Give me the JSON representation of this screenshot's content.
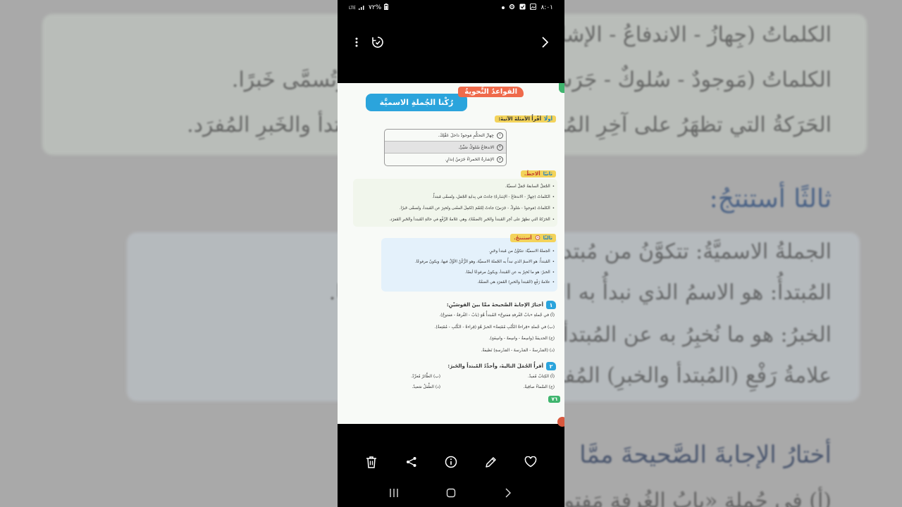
{
  "status": {
    "time": "٨:٠١",
    "battery": "%٧٢",
    "network": "LTE",
    "icons": [
      "dot-icon",
      "gear-icon",
      "check-icon",
      "gallery-icon"
    ]
  },
  "toolbar": {
    "more_icon": "more-vertical-icon",
    "rotate_icon": "rotate-icon",
    "forward_icon": "chevron-right-icon"
  },
  "document": {
    "lesson_badge": "القواعدُ النَّحويةُ",
    "lesson_title": "رُكْنا الجُملةِ الاسميَّة",
    "section1": {
      "number": "أولًا",
      "label": "أقْرأُ الأمثلةَ الآتيةَ:"
    },
    "examples": [
      {
        "num": "١",
        "text": "جِهازُ التحكُّمِ مَوجودٌ داخلَ عَقْلِكَ."
      },
      {
        "num": "٢",
        "text": "الاندفاعُ سُلوكٌ سَيِّئٌ."
      },
      {
        "num": "٣",
        "text": "الإشارةُ الحَمراءُ جَرَسُ إنذارٍ."
      }
    ],
    "section2": {
      "number": "ثانيًا",
      "label": "ألاحظُ."
    },
    "notes": [
      "الجُمَلُ السابقةُ جُمَلٌ اسميَّةٌ.",
      "الكلماتُ (جِهازُ - الاندفاعُ - الإشارةُ) جاءتْ في بِدايةِ الجُمَلِ، وتُسمَّى مُبتدأً.",
      "الكلماتُ (مَوجودٌ - سُلوكٌ - جَرَسُ) جاءتْ لِتُتَمِّمَ (تُكمِلَ المعْنى وتُخبِرَ عن المُبتدأ، وتُسمَّى خَبرًا.",
      "الحَرَكةُ التي تظهَرُ على آخِرِ المُبتدأ والخَبرِ (الضمَّةُ)، وهي عَلامةُ الرَّفْعِ في حالةِ المُبتدأ والخَبرِ المُفرَد."
    ],
    "section3": {
      "number": "ثالثًا",
      "label": "أستنتجُ."
    },
    "conclusions": [
      "الجملةُ الاسميَّةُ: تتكوَّنُ من مُبتدأ وخَبرٍ.",
      "المُبتدأُ: هو الاسمُ الذي نبدأُ به الجُملةَ الاسميَّةَ، وهو الرُّكْنُ الأوَّلُ فيها، ويكونُ مرفوعًا.",
      "الخبرُ: هو ما نُخبِرُ به عن المُبتدأ، ويكونُ مرفوعًا أيضًا.",
      "علامةُ رَفْعِ (المُبتدأ والخبرِ) المُفرَدِ هي الضمَّةُ."
    ],
    "question1": {
      "number": "١",
      "title": "أختارُ الإجابةَ الصَّحيحةَ ممَّا بينَ القوسَيْنِ:",
      "items": [
        "(أ) في جُملةِ «بابُ الغُرفةِ مَفتوحٌ» المُبتدأُ هُوَ (بابُ - الغُرفةُ - مَفتوحٌ).",
        "(ب) في جُملةِ «قِراءةُ الكُتُبِ مُمْتِعةٌ» الخبرُ هُوَ (قِراءةُ - الكُتُبِ - مُمْتِعةٌ).",
        "(ج) الحديقةُ (واسِعةٌ - واسِعةً - واسِعَةٍ).",
        "(د) (المَدْرسةُ - المَدْرسةَ - المَدْرسةِ) نَظيفةٌ."
      ]
    },
    "question2": {
      "number": "٢",
      "title": "أقرأُ الجُمَلَ التاليةَ، وأحدِّدُ المُبتدأَ والخَبرَ:",
      "items": [
        "(أ) الكِتابُ مُفيدٌ.",
        "(ب) الطَّائرُ مُغرِّدٌ.",
        "(ج) السَّماءُ صافِيةٌ.",
        "(د) الطِّفلُ سَعيدٌ."
      ]
    },
    "page_number": "٧٦"
  },
  "actions": {
    "delete_icon": "trash-icon",
    "share_icon": "share-icon",
    "info_icon": "info-icon",
    "edit_icon": "pencil-icon",
    "favorite_icon": "heart-icon"
  },
  "navigation": {
    "recents_icon": "recents-icon",
    "home_icon": "home-icon",
    "back_icon": "back-icon"
  },
  "background": {
    "lines": [
      "الكلماتُ (جِهازُ - الاندفاعُ - الإشارةُ) ... وتُسمَّى مُبتدأً.",
      "الكلماتُ (مَوجودٌ - سُلوكٌ - جَرَسُ) ... وتُخبِرَ عن المُبتدأ، وتُسمَّى خَبرًا.",
      "الحَرَكةُ التي تظهَرُ على آخِرِ المُبتدأ ... الرَّفْعِ في حالةِ المُبتدأ والخَبرِ المُفرَد.",
      "ثالثًا أستنتجُ:",
      "الجملةُ الاسميَّةُ: تتكوَّنُ من مُبتدأ وخَبرٍ.",
      "المُبتدأُ: هو الاسمُ الذي نبدأُ به الجُـ ... فيها، ويكونُ مرفوعًا.",
      "الخبرُ: هو ما نُخبِرُ به عن المُبتدأ،",
      "علامةُ رَفْعِ (المُبتدأ والخبرِ) المُفرَدِ",
      "أختارُ الإجابةَ الصَّحيحةَ ممَّا",
      "(أ) في جُملةِ «بابُ الغُرفةِ مَفتوحٌ» المُبتدأُ"
    ]
  }
}
